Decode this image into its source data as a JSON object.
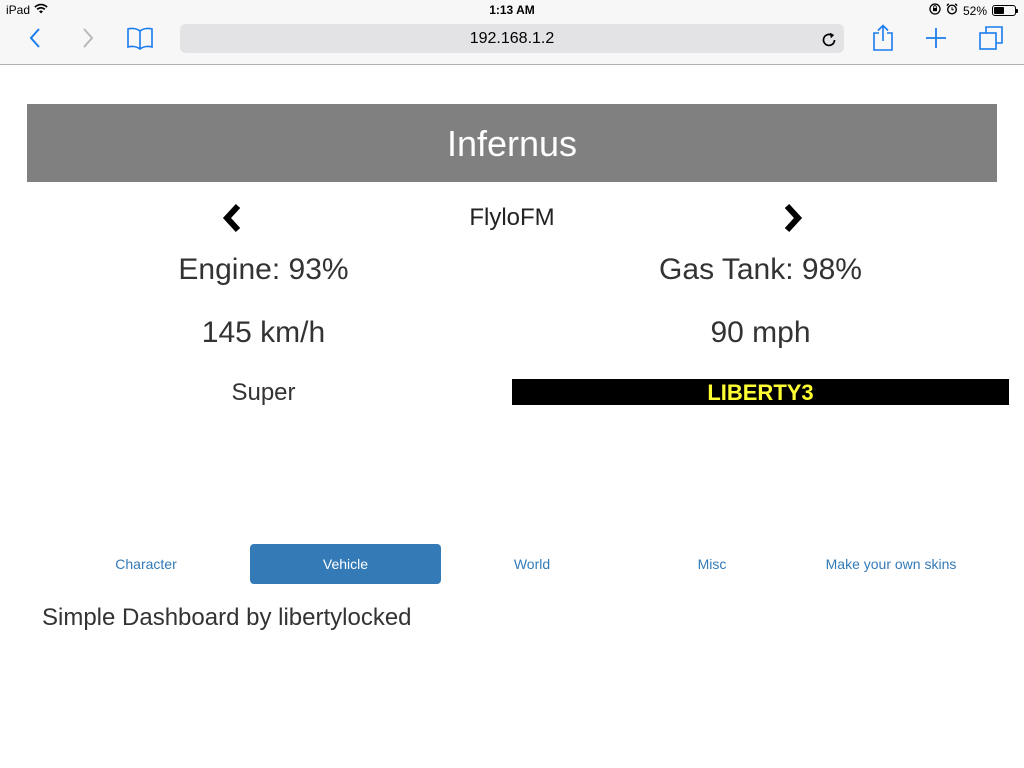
{
  "status_bar": {
    "device": "iPad",
    "time": "1:13 AM",
    "battery_percent_label": "52%",
    "battery_level": 0.52,
    "icons": [
      "wifi-icon",
      "orientation-lock-icon",
      "alarm-icon",
      "battery-icon"
    ]
  },
  "browser": {
    "url": "192.168.1.2",
    "icons": [
      "back-icon",
      "forward-icon",
      "bookmarks-icon",
      "reload-icon",
      "share-icon",
      "new-tab-icon",
      "tabs-icon"
    ],
    "accent_color": "#1a7cf0"
  },
  "vehicle": {
    "name": "Infernus",
    "radio_station": "FlyloFM",
    "engine": "Engine: 93%",
    "gas_tank": "Gas Tank: 98%",
    "speed_kmh": "145 km/h",
    "speed_mph": "90 mph",
    "class": "Super",
    "plate": "LIBERTY3"
  },
  "nav": {
    "tabs": [
      {
        "label": "Character"
      },
      {
        "label": "Vehicle",
        "active": true
      },
      {
        "label": "World"
      },
      {
        "label": "Misc"
      },
      {
        "label": "Make your own skins"
      }
    ]
  },
  "footer": {
    "credit": "Simple Dashboard by libertylocked"
  },
  "colors": {
    "header_bg": "#808080",
    "tab_active_bg": "#337ab7",
    "link": "#337ab7",
    "plate_bg": "#000000",
    "plate_text": "#ffff33"
  }
}
